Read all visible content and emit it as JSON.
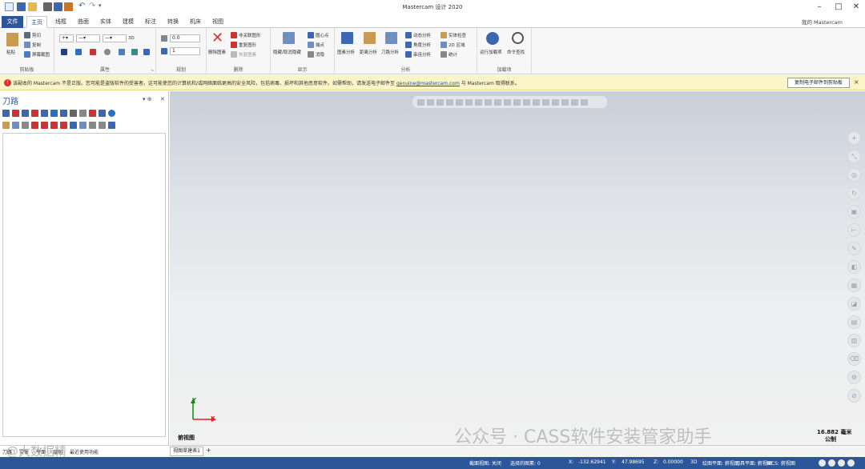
{
  "titlebar": {
    "title": "Mastercam 设计 2020",
    "minimize": "–",
    "maximize": "□",
    "close": "✕"
  },
  "tabs": {
    "file": "文件",
    "items": [
      "主页",
      "线框",
      "曲面",
      "实体",
      "建模",
      "标注",
      "转换",
      "机床",
      "视图"
    ],
    "active": "主页",
    "account": "我的 Mastercam"
  },
  "ribbon": {
    "clipboard": {
      "label": "剪贴板",
      "paste": "粘贴",
      "cut": "剪切",
      "copy": "复制",
      "paste_image": "屏幕截图"
    },
    "attributes": {
      "label": "属性",
      "dim": "3D",
      "value_z": "0.0",
      "value_level": "1"
    },
    "planning": {
      "label": "规划"
    },
    "delete": {
      "label": "删除",
      "delete_graphics": "删除图素",
      "delete_duplicates": "非关联图形",
      "restore": "重复图形",
      "recover": "恢复图素"
    },
    "display": {
      "label": "显示",
      "hide_unhide": "隐藏/取消隐藏",
      "center_point": "圆心点",
      "endpoints": "端点",
      "blank": "消隐"
    },
    "analysis": {
      "label": "分析",
      "entity_analysis": "图素分析",
      "distance_analysis": "距离分析",
      "toolpath_analysis": "刀路分析",
      "dynamic": "动态分析",
      "angle": "角度分析",
      "chain": "串连分析",
      "solid_check": "实体检查",
      "area_2d": "2D 区域",
      "stats": "统计"
    },
    "addins": {
      "label": "加载项",
      "run_addin": "运行加载项",
      "command_finder": "命令查找"
    }
  },
  "notification": {
    "text_before": "该副本的 Mastercam 不是正版。您可能是盗版软件的受害者。这可能使您的计算机和/或网络面临更高的安全风险，包括病毒、损坏和其他恶意软件。如需帮助，请发送电子邮件至",
    "email": "genuine@mastercam.com",
    "text_after": "与 Mastercam 取得联系。",
    "button": "复制电子邮件到剪贴板",
    "close": "×"
  },
  "left_panel": {
    "title": "刀路",
    "pin": "▾ ⊕",
    "close": "✕",
    "bottom_tabs": [
      "刀路",
      "实体",
      "平面",
      "层别",
      "最近使用功能"
    ]
  },
  "viewport": {
    "axis_x": "X",
    "axis_y": "Y",
    "view_name": "俯视图",
    "scale_value": "16.882 毫米",
    "scale_unit": "公制",
    "sheet_tab": "视图草建表1",
    "add_sheet": "+",
    "watermark": "公众号 · CASS软件安装管家助手",
    "watermark2": "@大数据精"
  },
  "status": {
    "section_view": "截面视图: 关闭",
    "selected": "选择的图素: 0",
    "x_label": "X:",
    "x_val": "-132.62941",
    "y_label": "Y:",
    "y_val": "47.98695",
    "z_label": "Z:",
    "z_val": "0.00000",
    "mode": "3D",
    "graphics_plane": "绘图平面: 俯视图",
    "tool_plane": "刀具平面: 俯视图",
    "wcs": "WCS: 俯视图"
  },
  "colors": {
    "accent": "#2b579a",
    "notify_bg": "#fbf4c6",
    "error": "#d9342b"
  }
}
